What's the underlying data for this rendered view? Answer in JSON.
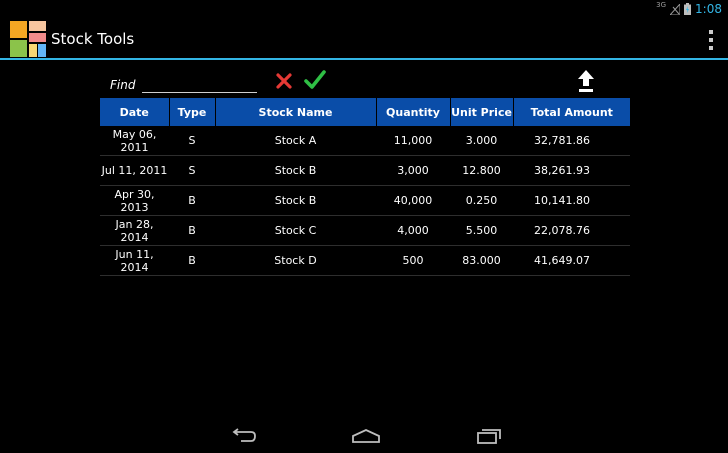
{
  "status_bar": {
    "network": "3G",
    "time": "1:08"
  },
  "app": {
    "title": "Stock Tools"
  },
  "find": {
    "label": "Find",
    "value": "",
    "placeholder": ""
  },
  "table": {
    "columns": [
      "Date",
      "Type",
      "Stock Name",
      "Quantity",
      "Unit Price",
      "Total Amount"
    ],
    "rows": [
      [
        "May 06, 2011",
        "S",
        "Stock A",
        "11,000",
        "3.000",
        "32,781.86"
      ],
      [
        "Jul 11, 2011",
        "S",
        "Stock B",
        "3,000",
        "12.800",
        "38,261.93"
      ],
      [
        "Apr 30, 2013",
        "B",
        "Stock B",
        "40,000",
        "0.250",
        "10,141.80"
      ],
      [
        "Jan 28, 2014",
        "B",
        "Stock C",
        "4,000",
        "5.500",
        "22,078.76"
      ],
      [
        "Jun 11, 2014",
        "B",
        "Stock D",
        "500",
        "83.000",
        "41,649.07"
      ]
    ]
  },
  "colors": {
    "accent": "#33b5e5",
    "header_bg": "#0a4da8",
    "clear_red": "#e53935",
    "confirm_green": "#2fbf45"
  },
  "icons": {
    "app": "stock-tools-app-icon",
    "clear": "x-icon",
    "confirm": "checkmark-icon",
    "upload": "upload-arrow-icon",
    "menu": "overflow-menu-icon",
    "back": "back-icon",
    "home": "home-icon",
    "recents": "recents-icon"
  }
}
